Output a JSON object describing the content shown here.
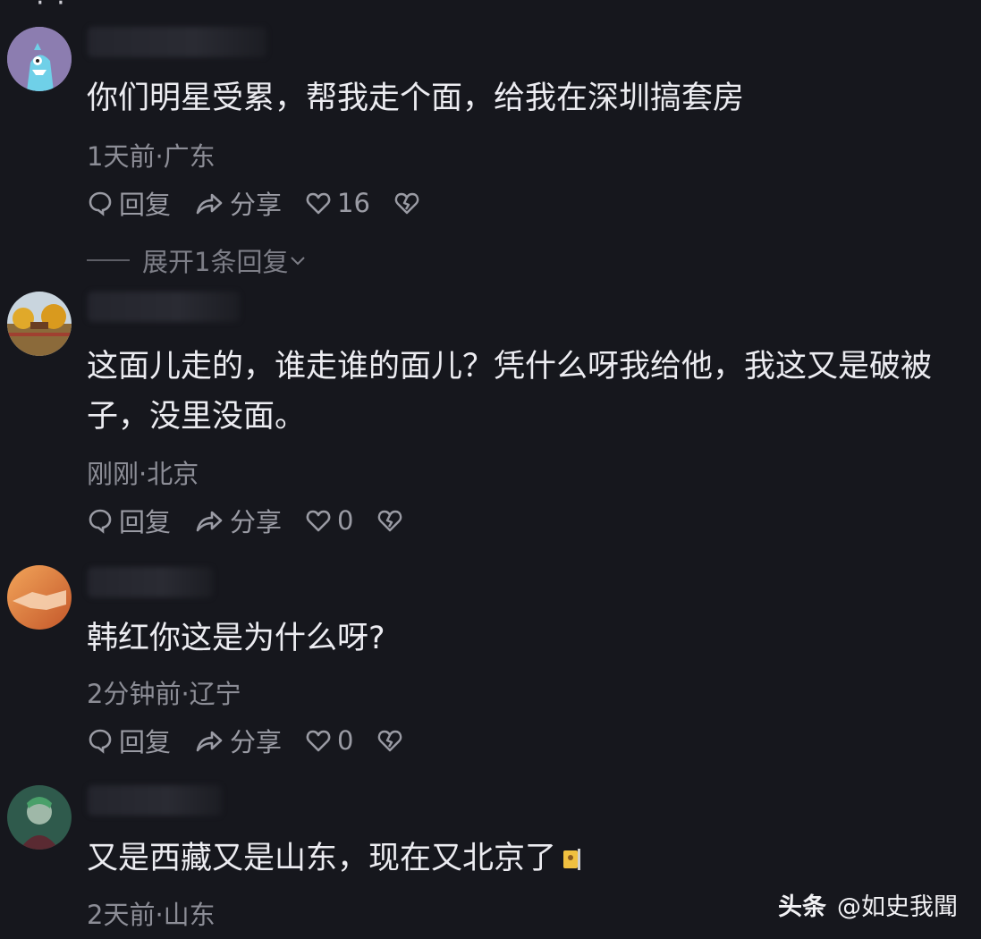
{
  "comments": [
    {
      "text": "你们明星受累，帮我走个面，给我在深圳搞套房",
      "meta": "1天前·广东",
      "reply_label": "回复",
      "share_label": "分享",
      "likes": "16",
      "expand_label": "展开1条回复"
    },
    {
      "text": "这面儿走的，谁走谁的面儿？凭什么呀我给他，我这又是破被子，没里没面。",
      "meta": "刚刚·北京",
      "reply_label": "回复",
      "share_label": "分享",
      "likes": "0"
    },
    {
      "text": "韩红你这是为什么呀?",
      "meta": "2分钟前·辽宁",
      "reply_label": "回复",
      "share_label": "分享",
      "likes": "0"
    },
    {
      "text": "又是西藏又是山东，现在又北京了",
      "meta": "2天前·山东"
    }
  ],
  "watermark": {
    "brand": "头条",
    "handle": "@如史我聞"
  },
  "icons": {
    "reply": "comment-bubble-icon",
    "share": "share-arrow-icon",
    "like": "heart-icon",
    "dislike": "broken-heart-icon",
    "expand": "chevron-down-icon"
  }
}
